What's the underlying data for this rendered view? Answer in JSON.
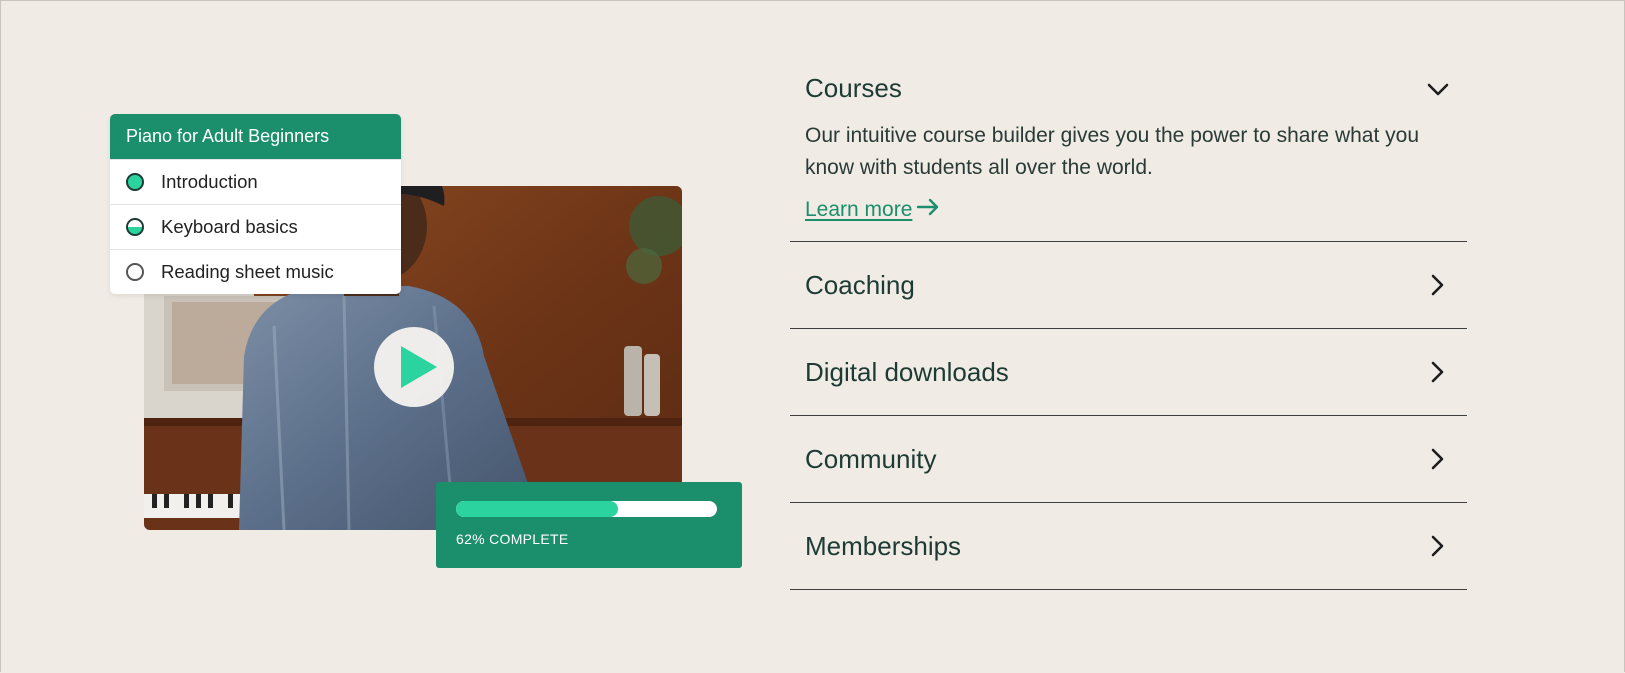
{
  "course_card": {
    "title": "Piano for Adult Beginners",
    "lessons": [
      {
        "label": "Introduction",
        "status": "complete"
      },
      {
        "label": "Keyboard basics",
        "status": "in-progress"
      },
      {
        "label": "Reading sheet music",
        "status": "not-started"
      }
    ]
  },
  "video": {
    "play_icon": "play-icon"
  },
  "progress": {
    "percent": 62,
    "label": "62% COMPLETE"
  },
  "accordion": {
    "items": [
      {
        "title": "Courses",
        "expanded": true,
        "description": "Our intuitive course builder gives you the power to share what you know with students all over the world.",
        "link_label": "Learn more"
      },
      {
        "title": "Coaching",
        "expanded": false
      },
      {
        "title": "Digital downloads",
        "expanded": false
      },
      {
        "title": "Community",
        "expanded": false
      },
      {
        "title": "Memberships",
        "expanded": false
      }
    ]
  },
  "colors": {
    "background": "#f0ebe5",
    "brand_green": "#1b8f6b",
    "accent_mint": "#2bd49f",
    "text_dark": "#1d3b34"
  }
}
